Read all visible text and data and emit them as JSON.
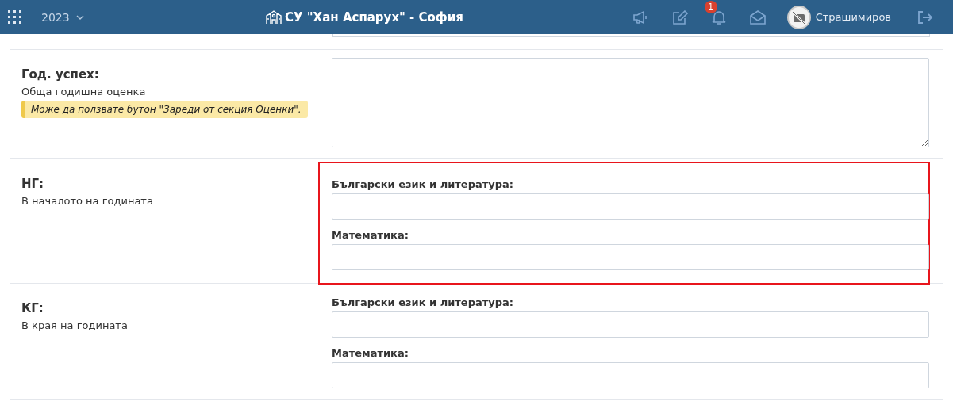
{
  "header": {
    "year": "2023",
    "school": "СУ \"Хан Аспарух\" - София",
    "notifications": "1",
    "user": "Страшимиров"
  },
  "sections": [
    {
      "kind": "textarea",
      "title": "Год. успех:",
      "subtitle": "Обща годишна оценка",
      "note": "Може да ползвате бутон \"Зареди от секция Оценки\".",
      "highlighted": false
    },
    {
      "kind": "subjects",
      "title": "НГ:",
      "subtitle": "В началото на годината",
      "highlighted": true,
      "fields": [
        {
          "label": "Български език и литература:"
        },
        {
          "label": "Математика:"
        }
      ]
    },
    {
      "kind": "subjects",
      "title": "КГ:",
      "subtitle": "В края на годината",
      "highlighted": false,
      "fields": [
        {
          "label": "Български език и литература:"
        },
        {
          "label": "Математика:"
        }
      ]
    }
  ]
}
